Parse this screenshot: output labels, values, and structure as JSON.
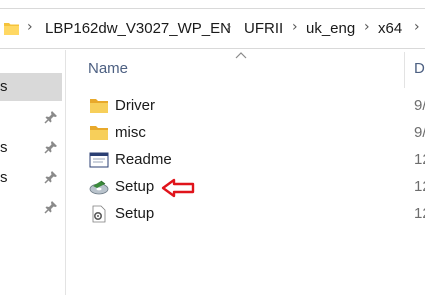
{
  "address": {
    "crumbs": [
      "LBP162dw_V3027_WP_EN",
      "UFRII",
      "uk_eng",
      "x64"
    ],
    "separator": "›"
  },
  "nav": {
    "items": [
      {
        "label": "s",
        "selected": true,
        "pinned": false
      },
      {
        "label": "",
        "selected": false,
        "pinned": true
      },
      {
        "label": "s",
        "selected": false,
        "pinned": true
      },
      {
        "label": "s",
        "selected": false,
        "pinned": true
      },
      {
        "label": "",
        "selected": false,
        "pinned": true
      }
    ]
  },
  "columns": {
    "name": "Name",
    "date": "D"
  },
  "files": [
    {
      "name": "Driver",
      "date": "9/",
      "icon": "folder-icon"
    },
    {
      "name": "misc",
      "date": "9/",
      "icon": "folder-icon"
    },
    {
      "name": "Readme",
      "date": "12",
      "icon": "document-window-icon"
    },
    {
      "name": "Setup",
      "date": "12",
      "icon": "setup-disc-icon"
    },
    {
      "name": "Setup",
      "date": "12",
      "icon": "settings-file-icon"
    }
  ],
  "annotation": {
    "icon": "red-arrow-icon",
    "color": "#e0141b"
  },
  "colors": {
    "folder": "#f5c33b",
    "selection": "#d9d9d9",
    "header_text": "#4d6082"
  }
}
